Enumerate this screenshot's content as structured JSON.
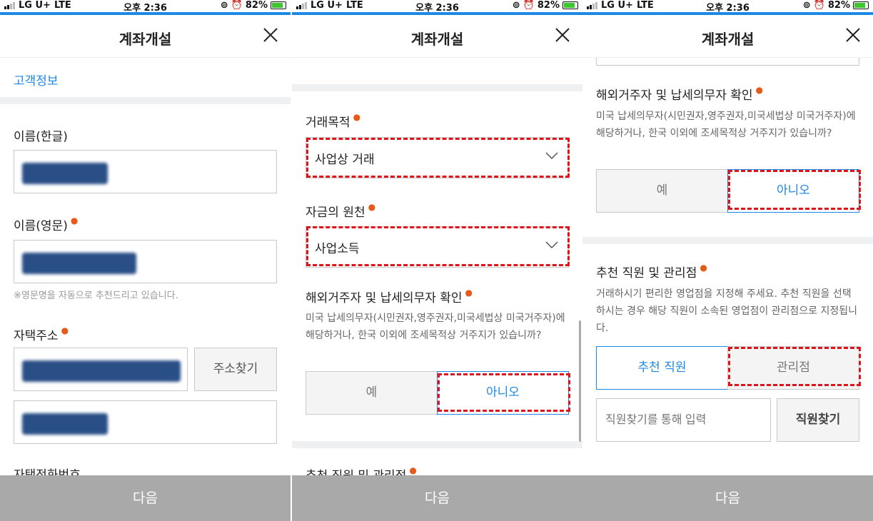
{
  "status": {
    "carrier": "LG U+",
    "network": "LTE",
    "time": "오후 2:36",
    "battery": "82%",
    "icons": [
      "signal-icon",
      "alarm-icon",
      "lock-rotation-icon",
      "battery-charging-icon"
    ]
  },
  "header": {
    "title": "계좌개설"
  },
  "footer": {
    "next_label": "다음"
  },
  "colors": {
    "accent": "#1e88e5",
    "required": "#e55b1c",
    "highlight": "#e0131b",
    "footer": "#a9a9a9"
  },
  "screen1": {
    "section_title": "고객정보",
    "name_kr_label": "이름(한글)",
    "name_en_label": "이름(영문)",
    "name_en_hint": "※영문명을 자동으로 추천드리고 있습니다.",
    "address_label": "자택주소",
    "address_search": "주소찾기",
    "phone_label": "자택전화번호"
  },
  "screen2": {
    "purpose_label": "거래목적",
    "purpose_value": "사업상 거래",
    "source_label": "자금의 원천",
    "source_value": "사업소득",
    "tax_label": "해외거주자 및 납세의무자 확인",
    "tax_desc": "미국 납세의무자(시민권자,영주권자,미국세법상 미국거주자)에 해당하거나, 한국 이외에 조세목적상 거주지가 있습니까?",
    "yes": "예",
    "no": "아니오",
    "recommend_label": "추천 직원 및 관리점"
  },
  "screen3": {
    "tax_label": "해외거주자 및 납세의무자 확인",
    "tax_desc": "미국 납세의무자(시민권자,영주권자,미국세법상 미국거주자)에 해당하거나, 한국 이외에 조세목적상 거주지가 있습니까?",
    "yes": "예",
    "no": "아니오",
    "recommend_label": "추천 직원 및 관리점",
    "recommend_desc": "거래하시기 편리한 영업점을 지정해 주세요. 추천 직원을 선택하시는 경우 해당 직원이 소속된 영업점이 관리점으로 지정됩니다.",
    "tab_staff": "추천 직원",
    "tab_branch": "관리점",
    "staff_placeholder": "직원찾기를 통해 입력",
    "staff_search": "직원찾기"
  }
}
